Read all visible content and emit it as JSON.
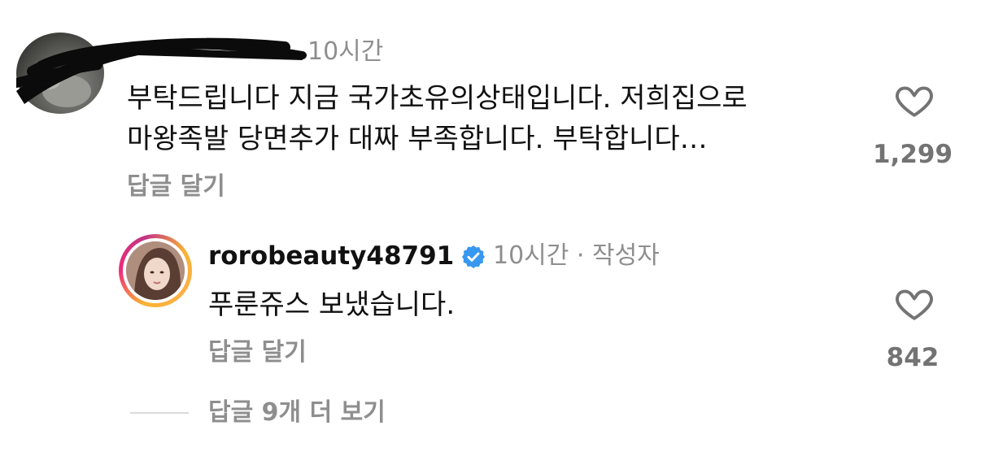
{
  "comment": {
    "avatar_icon": "profile-photo",
    "time": "10시간",
    "text_lines": [
      "부탁드립니다 지금 국가초유의상태입니다. 저희집으로",
      "마왕족발 당면추가 대짜 부족합니다. 부탁합니다…"
    ],
    "reply_label": "답글 달기",
    "like_icon": "heart-outline-icon",
    "likes": "1,299"
  },
  "reply": {
    "avatar_icon": "profile-photo-story-ring",
    "username": "rorobeauty48791",
    "verified_icon": "verified-badge-icon",
    "time_meta": "10시간 · 작성자",
    "text": "푸룬쥬스 보냈습니다.",
    "reply_label": "답글 달기",
    "like_icon": "heart-outline-icon",
    "likes": "842"
  },
  "view_more": {
    "label": "답글 9개 더 보기"
  },
  "colors": {
    "primary_text": "#111111",
    "secondary_text": "#8e8e8e",
    "like_count": "#737373",
    "verified_blue": "#3897f0"
  }
}
